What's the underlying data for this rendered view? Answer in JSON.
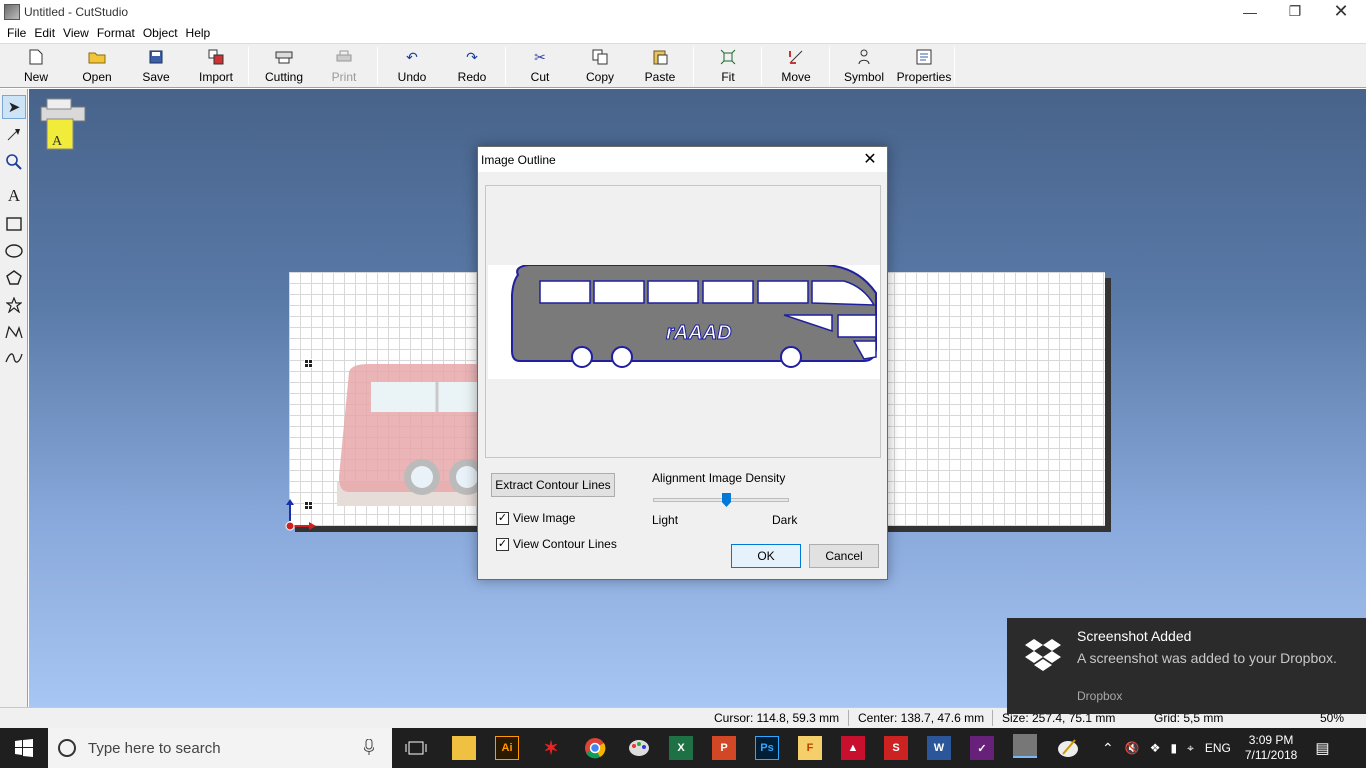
{
  "window": {
    "title": "Untitled - CutStudio"
  },
  "menu": [
    "File",
    "Edit",
    "View",
    "Format",
    "Object",
    "Help"
  ],
  "toolbar": [
    {
      "label": "New",
      "icon": "new-document-icon"
    },
    {
      "label": "Open",
      "icon": "open-folder-icon"
    },
    {
      "label": "Save",
      "icon": "save-disk-icon"
    },
    {
      "label": "Import",
      "icon": "import-icon"
    },
    {
      "label": "Cutting",
      "icon": "cutting-plotter-icon"
    },
    {
      "label": "Print",
      "icon": "printer-icon",
      "disabled": true
    },
    {
      "label": "Undo",
      "icon": "undo-icon"
    },
    {
      "label": "Redo",
      "icon": "redo-icon"
    },
    {
      "label": "Cut",
      "icon": "scissors-icon"
    },
    {
      "label": "Copy",
      "icon": "copy-icon"
    },
    {
      "label": "Paste",
      "icon": "paste-icon"
    },
    {
      "label": "Fit",
      "icon": "fit-icon"
    },
    {
      "label": "Move",
      "icon": "move-icon"
    },
    {
      "label": "Symbol",
      "icon": "symbol-icon"
    },
    {
      "label": "Properties",
      "icon": "properties-icon"
    }
  ],
  "tools": [
    "select-arrow-icon",
    "edit-node-icon",
    "zoom-icon",
    "text-tool-icon",
    "rectangle-tool-icon",
    "ellipse-tool-icon",
    "polygon-tool-icon",
    "star-tool-icon",
    "polyline-tool-icon",
    "curve-tool-icon"
  ],
  "dialog": {
    "title": "Image Outline",
    "extract_label": "Extract Contour Lines",
    "view_image_label": "View Image",
    "view_contour_label": "View Contour Lines",
    "view_image_checked": true,
    "view_contour_checked": true,
    "density_label": "Alignment Image Density",
    "density_light": "Light",
    "density_dark": "Dark",
    "density_value": 0.54,
    "ok_label": "OK",
    "cancel_label": "Cancel"
  },
  "status": {
    "cursor": "Cursor: 114.8, 59.3 mm",
    "center": "Center: 138.7, 47.6 mm",
    "size": "Size: 257.4, 75.1 mm",
    "grid": "Grid: 5,5 mm",
    "zoom": "50%"
  },
  "taskbar": {
    "search_placeholder": "Type here to search",
    "lang": "ENG",
    "time": "3:09 PM",
    "date": "7/11/2018"
  },
  "toast": {
    "title": "Screenshot Added",
    "body": "A screenshot was added to your Dropbox.",
    "source": "Dropbox"
  },
  "colors": {
    "accent": "#0078d7",
    "contour": "#1f1fa0",
    "taskbar": "#1f1f1f"
  }
}
